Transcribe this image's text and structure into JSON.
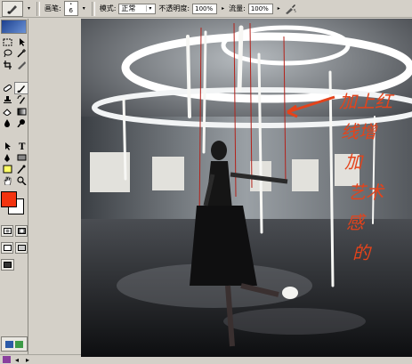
{
  "options_bar": {
    "brush_label": "画笔:",
    "brush_size": "6",
    "mode_label": "模式:",
    "mode_value": "正常",
    "opacity_label": "不透明度:",
    "opacity_value": "100%",
    "flow_label": "流量:",
    "flow_value": "100%"
  },
  "colors": {
    "foreground": "#f3330f",
    "background": "#ffffff"
  },
  "icons": {
    "tool_preset": "brush-preset-icon",
    "airbrush": "airbrush-icon",
    "imageready": "imageready-jump-icon"
  },
  "canvas_annotation": {
    "text": "加上红线增加艺术感的",
    "color": "#e4431b"
  }
}
